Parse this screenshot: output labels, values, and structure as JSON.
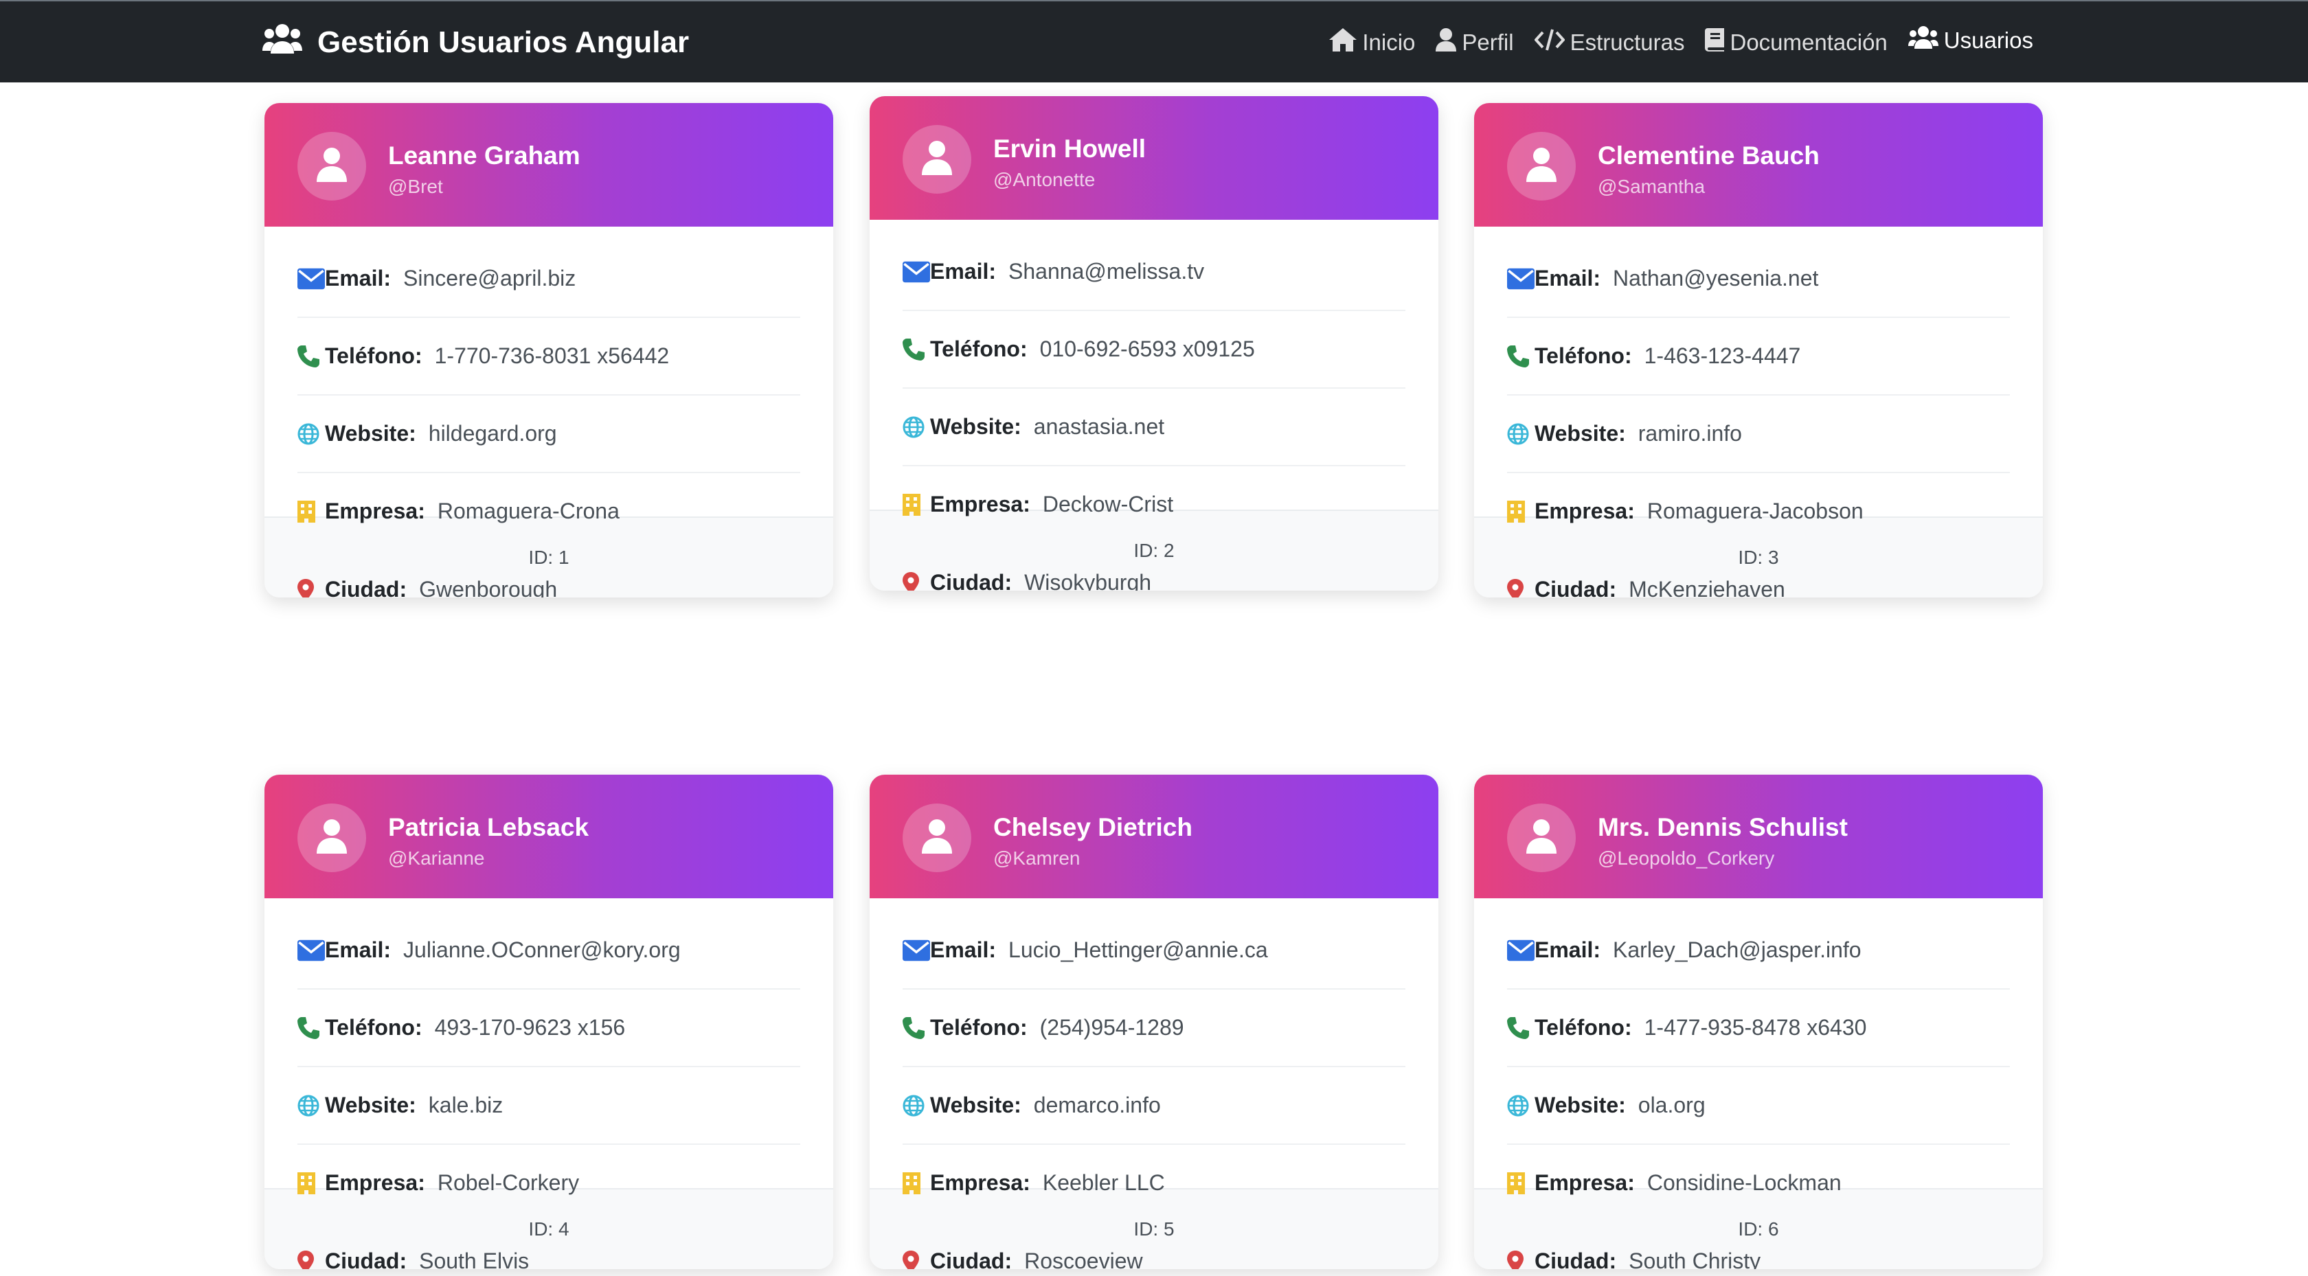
{
  "navbar": {
    "brand": "Gestión Usuarios Angular",
    "links": [
      {
        "label": "Inicio",
        "icon": "home-icon"
      },
      {
        "label": "Perfil",
        "icon": "user-icon"
      },
      {
        "label": "Estructuras",
        "icon": "code-icon"
      },
      {
        "label": "Documentación",
        "icon": "book-icon"
      },
      {
        "label": "Usuarios",
        "icon": "users-icon",
        "active": true
      }
    ]
  },
  "labels": {
    "email": "Email:",
    "phone": "Teléfono:",
    "website": "Website:",
    "company": "Empresa:",
    "city": "Ciudad:"
  },
  "colors": {
    "gradient_start": "#e6417e",
    "gradient_end": "#8d3ff0",
    "email_icon": "#2f6fe0",
    "phone_icon": "#2f8f4e",
    "website_icon": "#3ab7d8",
    "company_icon": "#f2c230",
    "city_icon": "#d94545"
  },
  "users": [
    {
      "name": "Leanne Graham",
      "username": "@Bret",
      "email": "Sincere@april.biz",
      "phone": "1-770-736-8031 x56442",
      "website": "hildegard.org",
      "company": "Romaguera-Crona",
      "city": "Gwenborough",
      "id": "ID: 1"
    },
    {
      "name": "Ervin Howell",
      "username": "@Antonette",
      "email": "Shanna@melissa.tv",
      "phone": "010-692-6593 x09125",
      "website": "anastasia.net",
      "company": "Deckow-Crist",
      "city": "Wisokyburgh",
      "id": "ID: 2"
    },
    {
      "name": "Clementine Bauch",
      "username": "@Samantha",
      "email": "Nathan@yesenia.net",
      "phone": "1-463-123-4447",
      "website": "ramiro.info",
      "company": "Romaguera-Jacobson",
      "city": "McKenziehaven",
      "id": "ID: 3"
    },
    {
      "name": "Patricia Lebsack",
      "username": "@Karianne",
      "email": "Julianne.OConner@kory.org",
      "phone": "493-170-9623 x156",
      "website": "kale.biz",
      "company": "Robel-Corkery",
      "city": "South Elvis",
      "id": "ID: 4"
    },
    {
      "name": "Chelsey Dietrich",
      "username": "@Kamren",
      "email": "Lucio_Hettinger@annie.ca",
      "phone": "(254)954-1289",
      "website": "demarco.info",
      "company": "Keebler LLC",
      "city": "Roscoeview",
      "id": "ID: 5"
    },
    {
      "name": "Mrs. Dennis Schulist",
      "username": "@Leopoldo_Corkery",
      "email": "Karley_Dach@jasper.info",
      "phone": "1-477-935-8478 x6430",
      "website": "ola.org",
      "company": "Considine-Lockman",
      "city": "South Christy",
      "id": "ID: 6"
    }
  ]
}
